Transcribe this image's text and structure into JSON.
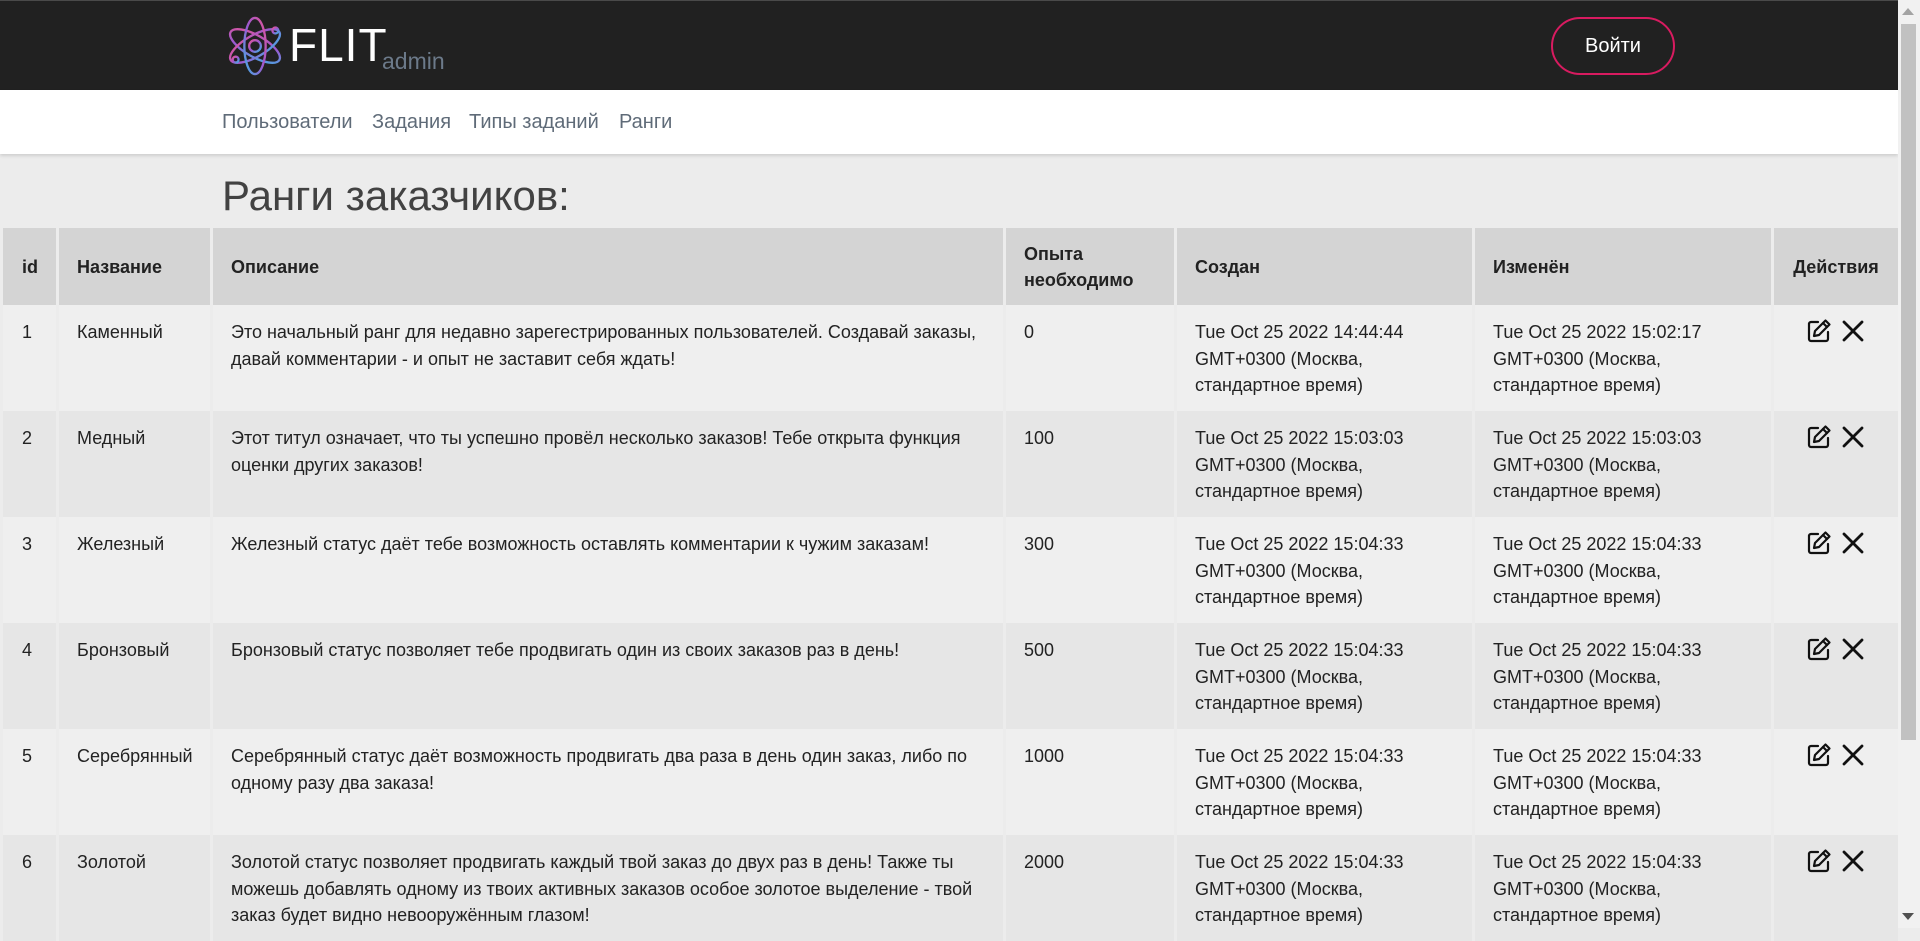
{
  "header": {
    "brand": "FLIT",
    "brand_sub": "admin",
    "login_label": "Войти",
    "accent": "#d81b60",
    "background": "#212121"
  },
  "nav": {
    "items": [
      "Пользователи",
      "Задания",
      "Типы заданий",
      "Ранги"
    ]
  },
  "page": {
    "title": "Ранги заказчиков:"
  },
  "table": {
    "columns": [
      "id",
      "Название",
      "Описание",
      "Опыта необходимо",
      "Создан",
      "Изменён",
      "Действия"
    ],
    "rows": [
      {
        "id": "1",
        "name": "Каменный",
        "description": "Это начальный ранг для недавно зарегестрированных пользователей. Создавай заказы, давай комментарии - и опыт не заставит себя ждать!",
        "exp": "0",
        "created": "Tue Oct 25 2022 14:44:44 GMT+0300 (Москва, стандартное время)",
        "updated": "Tue Oct 25 2022 15:02:17 GMT+0300 (Москва, стандартное время)"
      },
      {
        "id": "2",
        "name": "Медный",
        "description": "Этот титул означает, что ты успешно провёл несколько заказов! Тебе открыта функция оценки других заказов!",
        "exp": "100",
        "created": "Tue Oct 25 2022 15:03:03 GMT+0300 (Москва, стандартное время)",
        "updated": "Tue Oct 25 2022 15:03:03 GMT+0300 (Москва, стандартное время)"
      },
      {
        "id": "3",
        "name": "Железный",
        "description": "Железный статус даёт тебе возможность оставлять комментарии к чужим заказам!",
        "exp": "300",
        "created": "Tue Oct 25 2022 15:04:33 GMT+0300 (Москва, стандартное время)",
        "updated": "Tue Oct 25 2022 15:04:33 GMT+0300 (Москва, стандартное время)"
      },
      {
        "id": "4",
        "name": "Бронзовый",
        "description": "Бронзовый статус позволяет тебе продвигать один из своих заказов раз в день!",
        "exp": "500",
        "created": "Tue Oct 25 2022 15:04:33 GMT+0300 (Москва, стандартное время)",
        "updated": "Tue Oct 25 2022 15:04:33 GMT+0300 (Москва, стандартное время)"
      },
      {
        "id": "5",
        "name": "Серебрянный",
        "description": "Серебрянный статус даёт возможность продвигать два раза в день один заказ, либо по одному разу два заказа!",
        "exp": "1000",
        "created": "Tue Oct 25 2022 15:04:33 GMT+0300 (Москва, стандартное время)",
        "updated": "Tue Oct 25 2022 15:04:33 GMT+0300 (Москва, стандартное время)"
      },
      {
        "id": "6",
        "name": "Золотой",
        "description": "Золотой статус позволяет продвигать каждый твой заказ до двух раз в день! Также ты можешь добавлять одному из твоих активных заказов особое золотое выделение - твой заказ будет видно невооружённым глазом!",
        "exp": "2000",
        "created": "Tue Oct 25 2022 15:04:33 GMT+0300 (Москва, стандартное время)",
        "updated": "Tue Oct 25 2022 15:04:33 GMT+0300 (Москва, стандартное время)"
      }
    ],
    "row_actions": [
      "edit-icon",
      "delete-icon"
    ]
  }
}
